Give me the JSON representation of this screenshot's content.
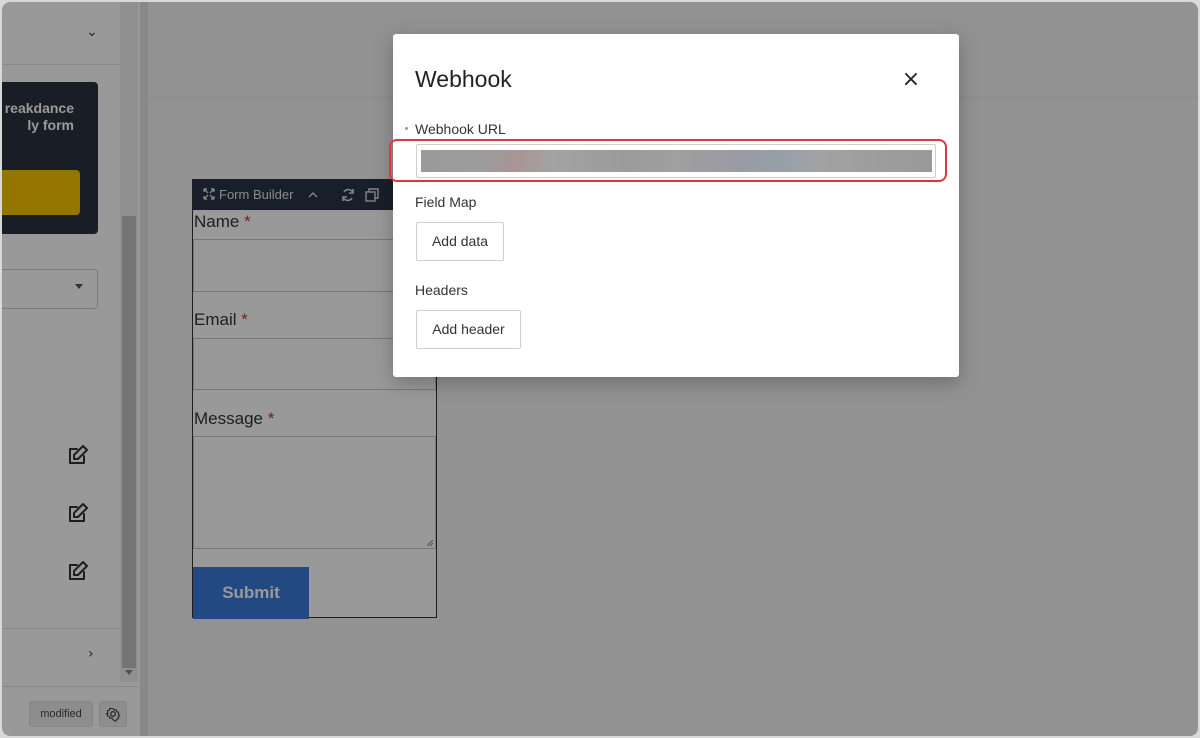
{
  "sidebar": {
    "promo": {
      "line1": "reakdance",
      "line2": "ly form"
    },
    "chevron_down": "⌄",
    "chevron_right": "›",
    "edit_icons": [
      "edit-icon",
      "edit-icon",
      "edit-icon"
    ]
  },
  "status_bar": {
    "modified_label": "modified"
  },
  "form_builder": {
    "toolbar_title": "Form Builder",
    "fields": [
      {
        "label": "Name",
        "required_mark": "*"
      },
      {
        "label": "Email",
        "required_mark": "*"
      },
      {
        "label": "Message",
        "required_mark": "*"
      }
    ],
    "submit_label": "Submit"
  },
  "modal": {
    "title": "Webhook",
    "close_icon": "×",
    "webhook_url_label": "Webhook URL",
    "field_map_label": "Field Map",
    "add_data_label": "Add data",
    "headers_label": "Headers",
    "add_header_label": "Add header"
  },
  "colors": {
    "highlight": "#e0363f",
    "promo_bg": "#2b3340",
    "promo_button": "#f6c300",
    "submit_bg": "#3b7ad9",
    "toolbar_bg": "#2a3547"
  }
}
